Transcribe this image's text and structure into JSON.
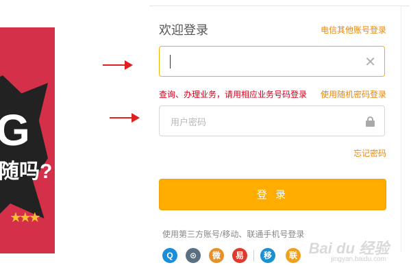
{
  "banner": {
    "big_text": "G",
    "text": "随吗?"
  },
  "login": {
    "welcome": "欢迎登录",
    "other_account": "电信其他账号登录",
    "phone": {
      "value": "",
      "clear_icon": "close-icon"
    },
    "hint": "查询、办理业务，请用相应业务号码登录",
    "random_password": "使用随机密码登录",
    "password": {
      "placeholder": "用户密码",
      "icon": "lock-icon"
    },
    "forgot": "忘记密码",
    "submit": "登 录",
    "third_party_text": "使用第三方账号/移动、联通手机号登录",
    "third_party_icons": [
      "qq-icon",
      "tianyi-icon",
      "weibo-icon",
      "yi-icon",
      "china-mobile-icon",
      "china-unicom-icon"
    ]
  },
  "watermark": {
    "main": "Bai du 经验",
    "sub": "jingyan.baidu.com"
  },
  "colors": {
    "accent": "#ffac00",
    "link": "#e8870e",
    "hint": "#d0021b",
    "banner": "#d4304a",
    "arrow": "#e02020"
  }
}
